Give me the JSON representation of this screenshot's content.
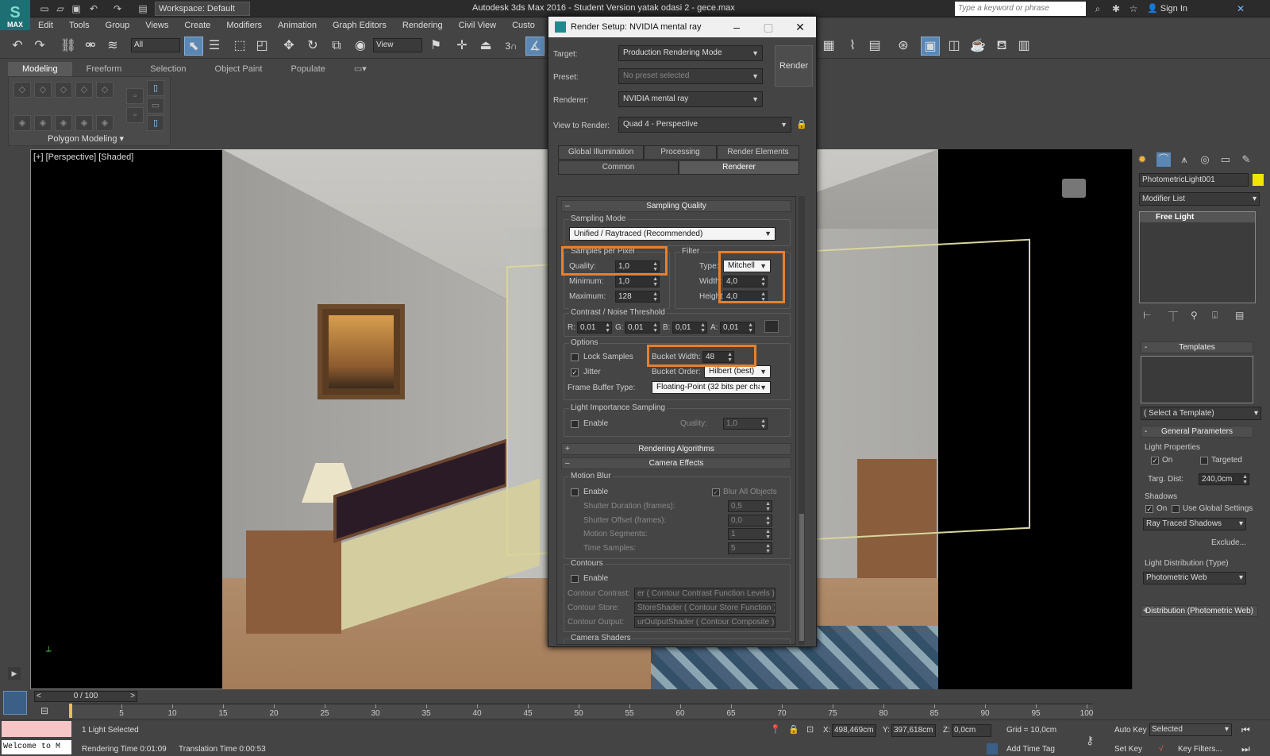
{
  "window": {
    "app_logo_text": "MAX",
    "title": "Autodesk 3ds Max 2016 - Student Version    yatak odasi 2 - gece.max",
    "workspace": "Workspace: Default",
    "search_placeholder": "Type a keyword or phrase",
    "sign_in": "Sign In"
  },
  "menu": [
    "Edit",
    "Tools",
    "Group",
    "Views",
    "Create",
    "Modifiers",
    "Animation",
    "Graph Editors",
    "Rendering",
    "Civil View",
    "Custo"
  ],
  "toolbar": {
    "selection_filter": "All",
    "ref_coord": "View",
    "snap_label": "3",
    "icons": [
      "undo-icon",
      "redo-icon",
      "link-icon",
      "unlink-icon",
      "bind-icon",
      "select-icon",
      "select-by-name-icon",
      "rect-region-icon",
      "window-crossing-icon",
      "move-icon",
      "rotate-icon",
      "scale-icon",
      "place-icon",
      "named-sets-icon",
      "pivot-icon",
      "snap-icon",
      "angle-snap-icon"
    ]
  },
  "ribbon": {
    "tabs": [
      "Modeling",
      "Freeform",
      "Selection",
      "Object Paint",
      "Populate"
    ],
    "active_tab": "Modeling",
    "panel_label": "Polygon Modeling"
  },
  "viewport": {
    "label": "[+] [Perspective] [Shaded]"
  },
  "dialog": {
    "title": "Render Setup: NVIDIA mental ray",
    "target_label": "Target:",
    "target_value": "Production Rendering Mode",
    "preset_label": "Preset:",
    "preset_value": "No preset selected",
    "renderer_label": "Renderer:",
    "renderer_value": "NVIDIA mental ray",
    "view_label": "View to Render:",
    "view_value": "Quad 4 - Perspective",
    "render_button": "Render",
    "tabs_row1": [
      "Global Illumination",
      "Processing",
      "Render Elements"
    ],
    "tabs_row2": [
      "Common",
      "Renderer"
    ],
    "active_tab": "Renderer",
    "sampling_quality": {
      "header": "Sampling Quality",
      "mode_label": "Sampling Mode",
      "mode_value": "Unified / Raytraced (Recommended)",
      "spp_label": "Samples per Pixel",
      "quality_label": "Quality:",
      "quality_value": "1,0",
      "min_label": "Minimum:",
      "min_value": "1,0",
      "max_label": "Maximum:",
      "max_value": "128",
      "filter_label": "Filter",
      "type_label": "Type:",
      "type_value": "Mitchell",
      "width_label": "Width:",
      "width_value": "4,0",
      "height_label": "Height:",
      "height_value": "4,0",
      "contrast_label": "Contrast / Noise Threshold",
      "r_label": "R:",
      "r_value": "0,01",
      "g_label": "G:",
      "g_value": "0,01",
      "b_label": "B:",
      "b_value": "0,01",
      "a_label": "A:",
      "a_value": "0,01",
      "options_label": "Options",
      "lock_samples": "Lock Samples",
      "jitter": "Jitter",
      "bucket_width_label": "Bucket Width:",
      "bucket_width_value": "48",
      "bucket_order_label": "Bucket Order:",
      "bucket_order_value": "Hilbert (best)",
      "frame_buffer_label": "Frame Buffer Type:",
      "frame_buffer_value": "Floating-Point (32 bits per cha",
      "lis_label": "Light Importance Sampling",
      "lis_enable": "Enable",
      "lis_quality_label": "Quality:",
      "lis_quality_value": "1,0"
    },
    "rendering_algorithms": "Rendering Algorithms",
    "camera_effects": {
      "header": "Camera Effects",
      "motion_blur": "Motion Blur",
      "enable": "Enable",
      "blur_all": "Blur All Objects",
      "shutter_duration_label": "Shutter Duration (frames):",
      "shutter_duration_value": "0,5",
      "shutter_offset_label": "Shutter Offset (frames):",
      "shutter_offset_value": "0,0",
      "motion_segments_label": "Motion Segments:",
      "motion_segments_value": "1",
      "time_samples_label": "Time Samples:",
      "time_samples_value": "5",
      "contours": "Contours",
      "contours_enable": "Enable",
      "contour_contrast_label": "Contour Contrast:",
      "contour_contrast_value": "er  ( Contour Contrast Function Levels )",
      "contour_store_label": "Contour Store:",
      "contour_store_value": "StoreShader  ( Contour Store Function )",
      "contour_output_label": "Contour Output:",
      "contour_output_value": "urOutputShader  ( Contour Composite )",
      "camera_shaders": "Camera Shaders"
    }
  },
  "command_panel": {
    "object_name": "PhotometricLight001",
    "modifier_list": "Modifier List",
    "stack_item": "Free Light",
    "templates_header": "Templates",
    "select_template": "( Select a Template)",
    "general_header": "General Parameters",
    "light_props": "Light Properties",
    "on": "On",
    "targeted": "Targeted",
    "targ_dist_label": "Targ. Dist:",
    "targ_dist_value": "240,0cm",
    "shadows": "Shadows",
    "shadows_on": "On",
    "use_global": "Use Global Settings",
    "shadow_type": "Ray Traced Shadows",
    "exclude": "Exclude...",
    "light_dist_label": "Light Distribution (Type)",
    "light_dist_value": "Photometric Web",
    "dist_rollout": "Distribution (Photometric Web)"
  },
  "timeline": {
    "frame": "0 / 100",
    "ticks": [
      "0",
      "5",
      "10",
      "15",
      "20",
      "25",
      "30",
      "35",
      "40",
      "45",
      "50",
      "55",
      "60",
      "65",
      "70",
      "75",
      "80",
      "85",
      "90",
      "95",
      "100"
    ]
  },
  "status": {
    "selection": "1 Light Selected",
    "maxscript": "Welcome to M",
    "render_time": "Rendering Time  0:01:09",
    "translation_time": "Translation Time  0:00:53",
    "x_label": "X:",
    "x_value": "498,469cm",
    "y_label": "Y:",
    "y_value": "397,618cm",
    "z_label": "Z:",
    "z_value": "0,0cm",
    "grid": "Grid = 10,0cm",
    "add_time_tag": "Add Time Tag",
    "auto_key": "Auto Key",
    "set_key": "Set Key",
    "selected": "Selected",
    "key_filters": "Key Filters..."
  },
  "colors": {
    "accent_highlight": "#e7802c",
    "selection_blue": "#5b87b4",
    "object_swatch": "#f2e600"
  }
}
